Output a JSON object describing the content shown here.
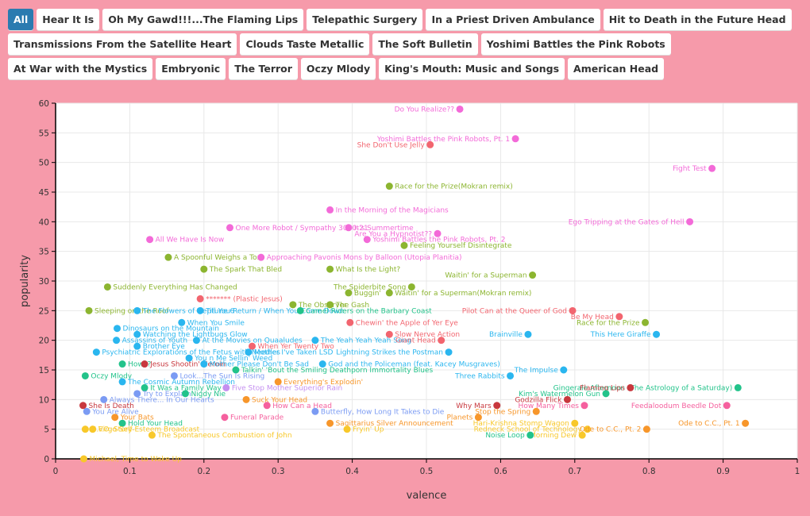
{
  "tabs": [
    {
      "label": "All",
      "active": true
    },
    {
      "label": "Hear It Is"
    },
    {
      "label": "Oh My Gawd!!!...The Flaming Lips"
    },
    {
      "label": "Telepathic Surgery"
    },
    {
      "label": "In a Priest Driven Ambulance"
    },
    {
      "label": "Hit to Death in the Future Head"
    },
    {
      "label": "Transmissions From the Satellite Heart"
    },
    {
      "label": "Clouds Taste Metallic"
    },
    {
      "label": "The Soft Bulletin"
    },
    {
      "label": "Yoshimi Battles the Pink Robots"
    },
    {
      "label": "At War with the Mystics"
    },
    {
      "label": "Embryonic"
    },
    {
      "label": "The Terror"
    },
    {
      "label": "Oczy Mlody"
    },
    {
      "label": "King's Mouth: Music and Songs"
    },
    {
      "label": "American Head"
    }
  ],
  "chart_data": {
    "type": "scatter",
    "xlabel": "valence",
    "ylabel": "popularity",
    "xlim": [
      0,
      1
    ],
    "ylim": [
      0,
      60
    ],
    "xticks": [
      "0",
      "0.1",
      "0.2",
      "0.3",
      "0.4",
      "0.5",
      "0.6",
      "0.7",
      "0.8",
      "0.9",
      "1"
    ],
    "yticks": [
      "0",
      "5",
      "10",
      "15",
      "20",
      "25",
      "30",
      "35",
      "40",
      "45",
      "50",
      "55",
      "60"
    ],
    "grid": true,
    "colors": {
      "pink": "#f36ad8",
      "green": "#8cb530",
      "red": "#f2656f",
      "blue": "#2ab6ef",
      "teal": "#22c38a",
      "orange": "#f7962a",
      "yellow": "#f8c82a",
      "darkred": "#c8383e",
      "periwinkle": "#7b9bf3",
      "lavender": "#c48ff0",
      "hotpink": "#f5609e"
    },
    "points": [
      {
        "x": 0.545,
        "y": 59,
        "label": "Do You Realize??",
        "color": "pink",
        "side": "left"
      },
      {
        "x": 0.62,
        "y": 54,
        "label": "Yoshimi Battles the Pink Robots, Pt. 1",
        "color": "pink",
        "side": "left"
      },
      {
        "x": 0.505,
        "y": 53,
        "label": "She Don't Use Jelly",
        "color": "red",
        "side": "left"
      },
      {
        "x": 0.885,
        "y": 49,
        "label": "Fight Test",
        "color": "pink",
        "side": "left"
      },
      {
        "x": 0.45,
        "y": 46,
        "label": "Race for the Prize(Mokran remix)",
        "color": "green",
        "side": "right"
      },
      {
        "x": 0.37,
        "y": 42,
        "label": "In the Morning of the Magicians",
        "color": "pink",
        "side": "right"
      },
      {
        "x": 0.855,
        "y": 40,
        "label": "Ego Tripping at the Gates of Hell",
        "color": "pink",
        "side": "left"
      },
      {
        "x": 0.235,
        "y": 39,
        "label": "One More Robot / Sympathy 3000-21",
        "color": "pink",
        "side": "right"
      },
      {
        "x": 0.395,
        "y": 39,
        "label": "It's Summertime",
        "color": "pink",
        "side": "right"
      },
      {
        "x": 0.515,
        "y": 38,
        "label": "Are You a Hypnotist??",
        "color": "pink",
        "side": "left"
      },
      {
        "x": 0.42,
        "y": 37,
        "label": "Yoshimi Battles the Pink Robots, Pt. 2",
        "color": "pink",
        "side": "right"
      },
      {
        "x": 0.127,
        "y": 37,
        "label": "All We Have Is Now",
        "color": "pink",
        "side": "right"
      },
      {
        "x": 0.47,
        "y": 36,
        "label": "Feeling Yourself Disintegrate",
        "color": "green",
        "side": "right"
      },
      {
        "x": 0.152,
        "y": 34,
        "label": "A Spoonful Weighs a Ton",
        "color": "green",
        "side": "right"
      },
      {
        "x": 0.277,
        "y": 34,
        "label": "Approaching Pavonis Mons by Balloon (Utopia Planitia)",
        "color": "pink",
        "side": "right"
      },
      {
        "x": 0.2,
        "y": 32,
        "label": "The Spark That Bled",
        "color": "green",
        "side": "right"
      },
      {
        "x": 0.37,
        "y": 32,
        "label": "What Is the Light?",
        "color": "green",
        "side": "right"
      },
      {
        "x": 0.643,
        "y": 31,
        "label": "Waitin' for a Superman",
        "color": "green",
        "side": "left"
      },
      {
        "x": 0.07,
        "y": 29,
        "label": "Suddenly Everything Has Changed",
        "color": "green",
        "side": "right"
      },
      {
        "x": 0.48,
        "y": 29,
        "label": "The Spiderbite Song",
        "color": "green",
        "side": "left"
      },
      {
        "x": 0.395,
        "y": 28,
        "label": "Buggin'",
        "color": "green",
        "side": "right"
      },
      {
        "x": 0.45,
        "y": 28,
        "label": "Waitin' for a Superman(Mokran remix)",
        "color": "green",
        "side": "right"
      },
      {
        "x": 0.195,
        "y": 27,
        "label": "******* (Plastic Jesus)",
        "color": "red",
        "side": "right"
      },
      {
        "x": 0.32,
        "y": 26,
        "label": "The Observer",
        "color": "green",
        "side": "right"
      },
      {
        "x": 0.37,
        "y": 26,
        "label": "The Gash",
        "color": "green",
        "side": "right"
      },
      {
        "x": 0.045,
        "y": 25,
        "label": "Sleeping on the Roof",
        "color": "green",
        "side": "right"
      },
      {
        "x": 0.11,
        "y": 25,
        "label": "The Flowers of Neptune 6",
        "color": "blue",
        "side": "right"
      },
      {
        "x": 0.195,
        "y": 25,
        "label": "Till You Return / When You Come Down",
        "color": "blue",
        "side": "right"
      },
      {
        "x": 0.33,
        "y": 25,
        "label": "Camel Riders on the Barbary Coast",
        "color": "teal",
        "side": "right"
      },
      {
        "x": 0.697,
        "y": 25,
        "label": "Pilot Can at the Queer of God",
        "color": "red",
        "side": "left"
      },
      {
        "x": 0.76,
        "y": 24,
        "label": "Be My Head",
        "color": "red",
        "side": "left"
      },
      {
        "x": 0.795,
        "y": 23,
        "label": "Race for the Prize",
        "color": "green",
        "side": "left"
      },
      {
        "x": 0.17,
        "y": 23,
        "label": "When You Smile",
        "color": "blue",
        "side": "right"
      },
      {
        "x": 0.397,
        "y": 23,
        "label": "Chewin' the Apple of Yer Eye",
        "color": "red",
        "side": "right"
      },
      {
        "x": 0.083,
        "y": 22,
        "label": "Dinosaurs on the Mountain",
        "color": "blue",
        "side": "right"
      },
      {
        "x": 0.11,
        "y": 21,
        "label": "Watching the Lightbugs Glow",
        "color": "blue",
        "side": "right"
      },
      {
        "x": 0.45,
        "y": 21,
        "label": "Slow Nerve Action",
        "color": "red",
        "side": "right"
      },
      {
        "x": 0.81,
        "y": 21,
        "label": "This Here Giraffe",
        "color": "blue",
        "side": "left"
      },
      {
        "x": 0.637,
        "y": 21,
        "label": "Brainville",
        "color": "blue",
        "side": "left"
      },
      {
        "x": 0.082,
        "y": 20,
        "label": "Assassins of Youth",
        "color": "blue",
        "side": "right"
      },
      {
        "x": 0.19,
        "y": 20,
        "label": "At the Movies on Quaaludes",
        "color": "blue",
        "side": "right"
      },
      {
        "x": 0.35,
        "y": 20,
        "label": "The Yeah Yeah Yeah Song",
        "color": "blue",
        "side": "right"
      },
      {
        "x": 0.52,
        "y": 20,
        "label": "Giant Head",
        "color": "red",
        "side": "left"
      },
      {
        "x": 0.11,
        "y": 19,
        "label": "Brother Eye",
        "color": "blue",
        "side": "right"
      },
      {
        "x": 0.265,
        "y": 19,
        "label": "When Yer Twenty Two",
        "color": "red",
        "side": "right"
      },
      {
        "x": 0.055,
        "y": 18,
        "label": "Psychiatric Explorations of the Fetus with Needles",
        "color": "blue",
        "side": "right"
      },
      {
        "x": 0.26,
        "y": 18,
        "label": "Mother I've Taken LSD",
        "color": "blue",
        "side": "right"
      },
      {
        "x": 0.53,
        "y": 18,
        "label": "Lightning Strikes the Postman",
        "color": "blue",
        "side": "left"
      },
      {
        "x": 0.18,
        "y": 17,
        "label": "You n Me Sellin' Weed",
        "color": "blue",
        "side": "right"
      },
      {
        "x": 0.09,
        "y": 16,
        "label": "How??",
        "color": "teal",
        "side": "right"
      },
      {
        "x": 0.12,
        "y": 16,
        "label": "Jesus Shootin' Heroin",
        "color": "darkred",
        "side": "right"
      },
      {
        "x": 0.2,
        "y": 16,
        "label": "Mother Please Don't Be Sad",
        "color": "blue",
        "side": "right"
      },
      {
        "x": 0.36,
        "y": 16,
        "label": "God and the Policeman (feat. Kacey Musgraves)",
        "color": "blue",
        "side": "right"
      },
      {
        "x": 0.04,
        "y": 14,
        "label": "Oczy Mlody",
        "color": "teal",
        "side": "right"
      },
      {
        "x": 0.243,
        "y": 15,
        "label": "Talkin' 'Bout the Smiling Deathporn Immortality Blues",
        "color": "teal",
        "side": "right"
      },
      {
        "x": 0.685,
        "y": 15,
        "label": "The Impulse",
        "color": "blue",
        "side": "left"
      },
      {
        "x": 0.16,
        "y": 14,
        "label": "Look...The Sun Is Rising",
        "color": "periwinkle",
        "side": "right"
      },
      {
        "x": 0.613,
        "y": 14,
        "label": "Three Rabbits",
        "color": "blue",
        "side": "left"
      },
      {
        "x": 0.09,
        "y": 13,
        "label": "The Cosmic Autumn Rebellion",
        "color": "blue",
        "side": "right"
      },
      {
        "x": 0.3,
        "y": 13,
        "label": "Everything's Explodin'",
        "color": "orange",
        "side": "right"
      },
      {
        "x": 0.12,
        "y": 12,
        "label": "It Was a Family Way",
        "color": "teal",
        "side": "right"
      },
      {
        "x": 0.23,
        "y": 12,
        "label": "Five Stop Mother Superior Rain",
        "color": "lavender",
        "side": "right"
      },
      {
        "x": 0.92,
        "y": 12,
        "label": "Gingerale Afternoon (The Astrology of a Saturday)",
        "color": "teal",
        "side": "left"
      },
      {
        "x": 0.775,
        "y": 12,
        "label": "Flaming Lips",
        "color": "darkred",
        "side": "left"
      },
      {
        "x": 0.11,
        "y": 11,
        "label": "Try to Explain",
        "color": "periwinkle",
        "side": "right"
      },
      {
        "x": 0.175,
        "y": 11,
        "label": "Nigdy Nie",
        "color": "teal",
        "side": "right"
      },
      {
        "x": 0.742,
        "y": 11,
        "label": "Kim's Watermelon Gun",
        "color": "teal",
        "side": "left"
      },
      {
        "x": 0.065,
        "y": 10,
        "label": "Always There... In Our Hearts",
        "color": "periwinkle",
        "side": "right"
      },
      {
        "x": 0.257,
        "y": 10,
        "label": "Suck Your Head",
        "color": "orange",
        "side": "right"
      },
      {
        "x": 0.69,
        "y": 10,
        "label": "Godzilla Flick",
        "color": "darkred",
        "side": "left"
      },
      {
        "x": 0.037,
        "y": 9,
        "label": "She Is Death",
        "color": "darkred",
        "side": "right"
      },
      {
        "x": 0.285,
        "y": 9,
        "label": "How Can a Head",
        "color": "hotpink",
        "side": "right"
      },
      {
        "x": 0.595,
        "y": 9,
        "label": "Why Mars",
        "color": "darkred",
        "side": "left"
      },
      {
        "x": 0.713,
        "y": 9,
        "label": "How Many Times",
        "color": "hotpink",
        "side": "left"
      },
      {
        "x": 0.905,
        "y": 9,
        "label": "Feedaloodum Beedle Dot",
        "color": "hotpink",
        "side": "left"
      },
      {
        "x": 0.042,
        "y": 8,
        "label": "You Are Alive",
        "color": "periwinkle",
        "side": "right"
      },
      {
        "x": 0.35,
        "y": 8,
        "label": "Butterfly, How Long It Takes to Die",
        "color": "periwinkle",
        "side": "right"
      },
      {
        "x": 0.648,
        "y": 8,
        "label": "Stop the Spring",
        "color": "orange",
        "side": "left"
      },
      {
        "x": 0.08,
        "y": 7,
        "label": "Your Bats",
        "color": "orange",
        "side": "right"
      },
      {
        "x": 0.57,
        "y": 7,
        "label": "Planets",
        "color": "orange",
        "side": "left"
      },
      {
        "x": 0.228,
        "y": 7,
        "label": "Funeral Parade",
        "color": "hotpink",
        "side": "right"
      },
      {
        "x": 0.09,
        "y": 6,
        "label": "Hold Your Head",
        "color": "teal",
        "side": "right"
      },
      {
        "x": 0.37,
        "y": 6,
        "label": "Sagittarius Silver Announcement",
        "color": "orange",
        "side": "right"
      },
      {
        "x": 0.7,
        "y": 6,
        "label": "Hari-Krishna Stomp Wagon",
        "color": "yellow",
        "side": "left"
      },
      {
        "x": 0.93,
        "y": 6,
        "label": "Ode to C.C., Pt. 1",
        "color": "orange",
        "side": "left"
      },
      {
        "x": 0.04,
        "y": 5,
        "label": "U.F.O. Story",
        "color": "yellow",
        "side": "right"
      },
      {
        "x": 0.05,
        "y": 5,
        "label": "Virgo Self-Esteem Broadcast",
        "color": "yellow",
        "side": "right"
      },
      {
        "x": 0.393,
        "y": 5,
        "label": "Fryin' Up",
        "color": "yellow",
        "side": "right"
      },
      {
        "x": 0.717,
        "y": 5,
        "label": "Redneck School of Technology",
        "color": "yellow",
        "side": "left"
      },
      {
        "x": 0.797,
        "y": 5,
        "label": "Ode to C.C., Pt. 2",
        "color": "orange",
        "side": "left"
      },
      {
        "x": 0.13,
        "y": 4,
        "label": "The Spontaneous Combustion of John",
        "color": "yellow",
        "side": "right"
      },
      {
        "x": 0.71,
        "y": 4,
        "label": "Morning Dew",
        "color": "yellow",
        "side": "left"
      },
      {
        "x": 0.64,
        "y": 4,
        "label": "Noise Loop",
        "color": "teal",
        "side": "left"
      },
      {
        "x": 0.038,
        "y": 0,
        "label": "Michael, Time to Wake Up",
        "color": "yellow",
        "side": "right"
      }
    ]
  }
}
